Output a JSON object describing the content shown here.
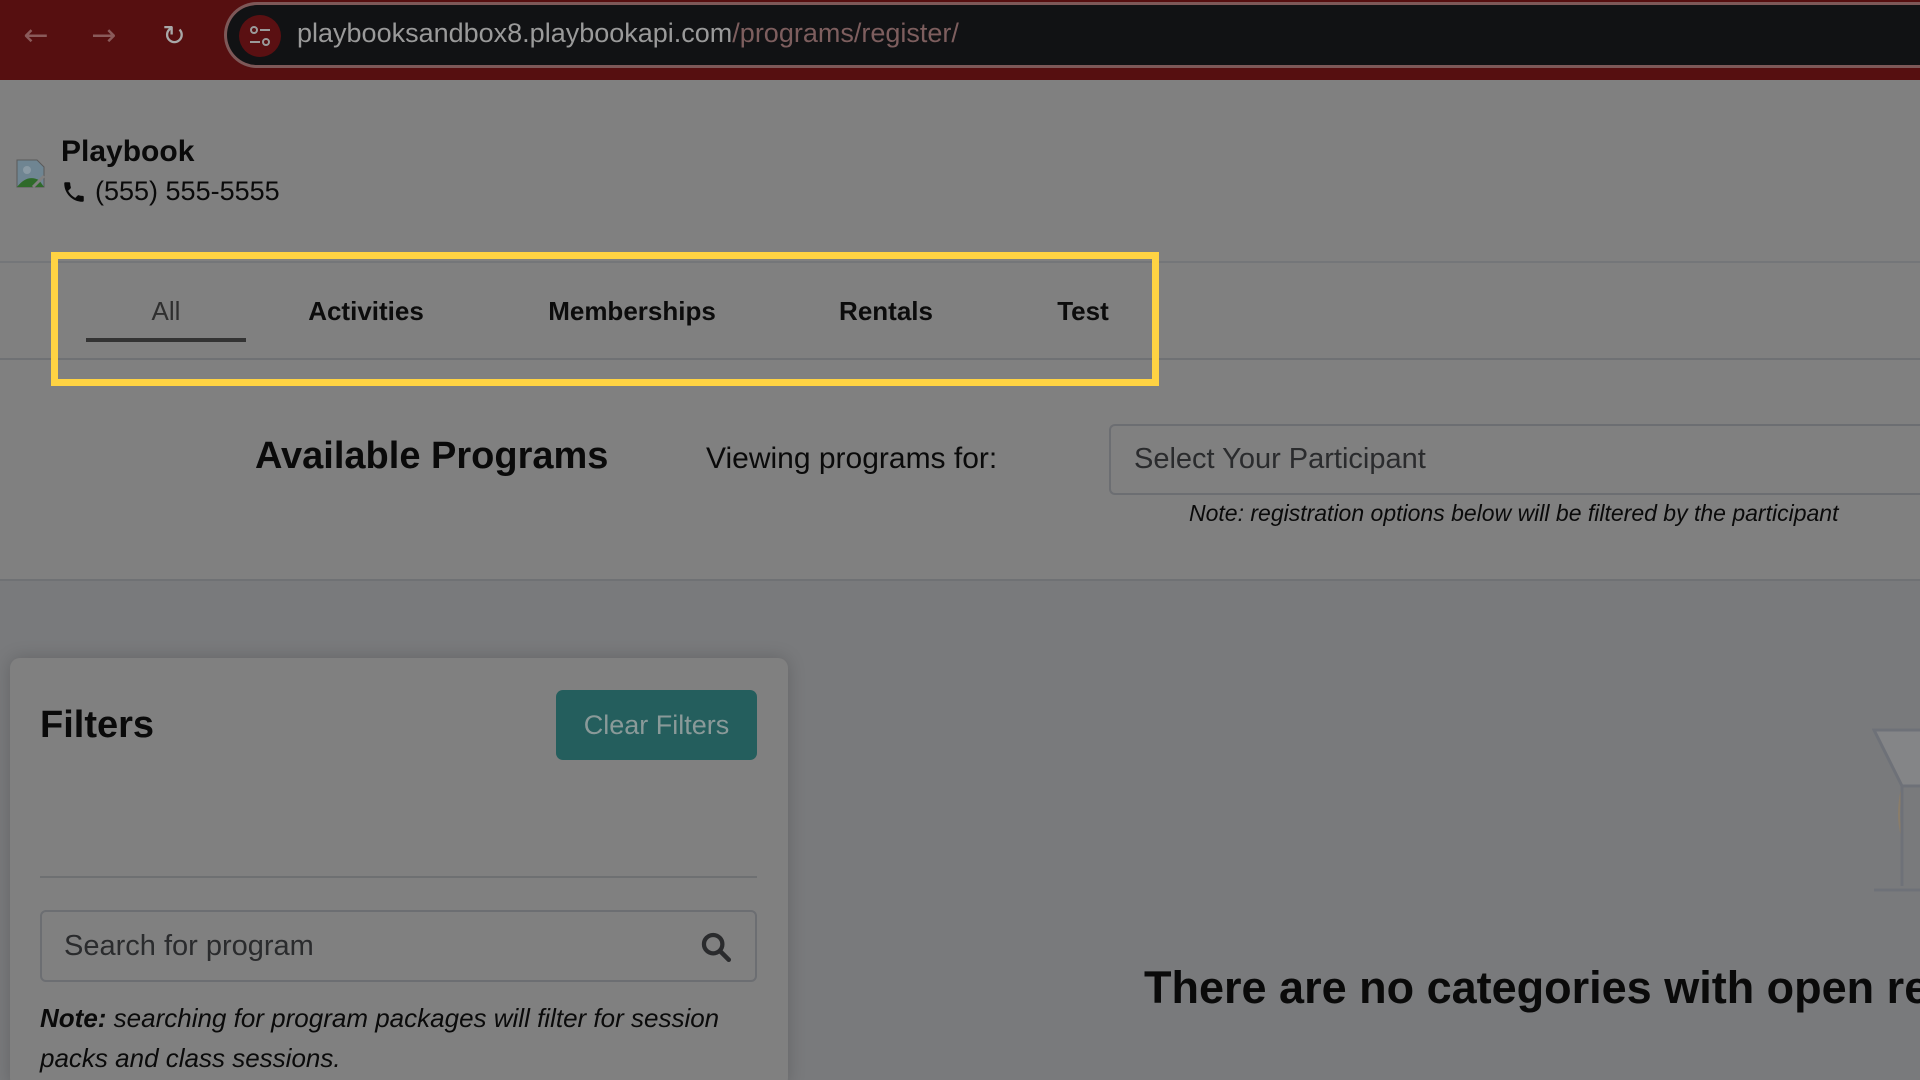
{
  "browser": {
    "url_host": "playbooksandbox8.playbookapi.com",
    "url_path": "/programs/register/",
    "back_icon": "arrow-left-icon",
    "forward_icon": "arrow-right-icon",
    "reload_icon": "reload-icon",
    "site_info_icon": "tune-icon"
  },
  "header": {
    "brand_name": "Playbook",
    "phone": "(555) 555-5555",
    "logo_icon": "broken-image-icon",
    "phone_icon": "phone-icon"
  },
  "tabs": {
    "items": [
      {
        "label": "All",
        "active": true
      },
      {
        "label": "Activities",
        "active": false
      },
      {
        "label": "Memberships",
        "active": false
      },
      {
        "label": "Rentals",
        "active": false
      },
      {
        "label": "Test",
        "active": false
      }
    ]
  },
  "programs": {
    "title": "Available Programs",
    "viewing_label": "Viewing programs for:",
    "participant_placeholder": "Select Your Participant",
    "participant_note": "Note: registration options below will be filtered by the participant"
  },
  "filters": {
    "title": "Filters",
    "clear_label": "Clear Filters",
    "search_placeholder": "Search for program",
    "note_bold": "Note:",
    "note_text": " searching for program packages will filter for session packs and class sessions."
  },
  "empty_state": {
    "icon": "cocktail-glass-icon",
    "message": "There are no categories with open re"
  },
  "colors": {
    "highlight": "#ffd343",
    "button_bg": "#245e5d",
    "browser_bar": "#560f10"
  }
}
